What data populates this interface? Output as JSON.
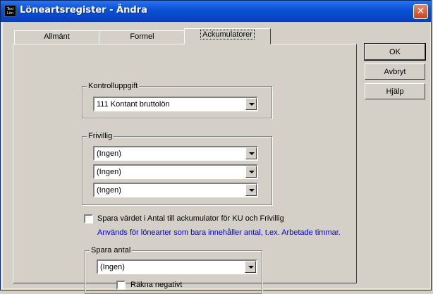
{
  "window": {
    "title": "Löneartsregister - Ändra",
    "app_icon_text_top": "Texi",
    "app_icon_text_bottom": "Lön",
    "close_glyph": "✕"
  },
  "tabs": [
    {
      "label": "Allmänt",
      "active": false
    },
    {
      "label": "Formel",
      "active": false
    },
    {
      "label": "Ackumulatorer",
      "active": true
    }
  ],
  "kontrolluppgift": {
    "label": "Kontrolluppgift",
    "value": "111  Kontant bruttolön"
  },
  "frivillig": {
    "label": "Frivillig",
    "values": [
      "(Ingen)",
      "(Ingen)",
      "(Ingen)"
    ]
  },
  "spara_varde": {
    "label": "Spara värdet i Antal till ackumulator för KU och Frivillig",
    "checked": false,
    "hint": "Används för lönearter som bara innehåller antal, t.ex. Arbetade timmar."
  },
  "spara_antal": {
    "label": "Spara antal",
    "value": "(Ingen)",
    "rakna_negativt": {
      "label": "Räkna negativt",
      "checked": false
    }
  },
  "buttons": {
    "ok": "OK",
    "cancel": "Avbryt",
    "help": "Hjälp"
  },
  "colors": {
    "titlebar": "#0a53d8",
    "face": "#d4d0c8",
    "hint_text": "#0000cc",
    "close_button": "#c9431f"
  }
}
